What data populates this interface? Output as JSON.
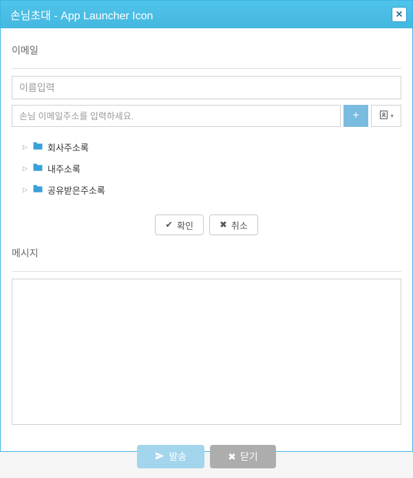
{
  "window": {
    "title": "손님초대 - App Launcher Icon"
  },
  "email": {
    "section_label": "이메일",
    "name_placeholder": "이름입력",
    "email_placeholder": "손님 이메일주소를 입력하세요.",
    "add_label": "+",
    "tree": [
      {
        "label": "회사주소록"
      },
      {
        "label": "내주소록"
      },
      {
        "label": "공유받은주소록"
      }
    ],
    "confirm_label": "확인",
    "cancel_label": "취소"
  },
  "message": {
    "section_label": "메시지"
  },
  "footer": {
    "send_label": "발송",
    "close_label": "닫기"
  },
  "colors": {
    "titlebar": "#45b8e0",
    "accent": "#3aa1d8"
  }
}
